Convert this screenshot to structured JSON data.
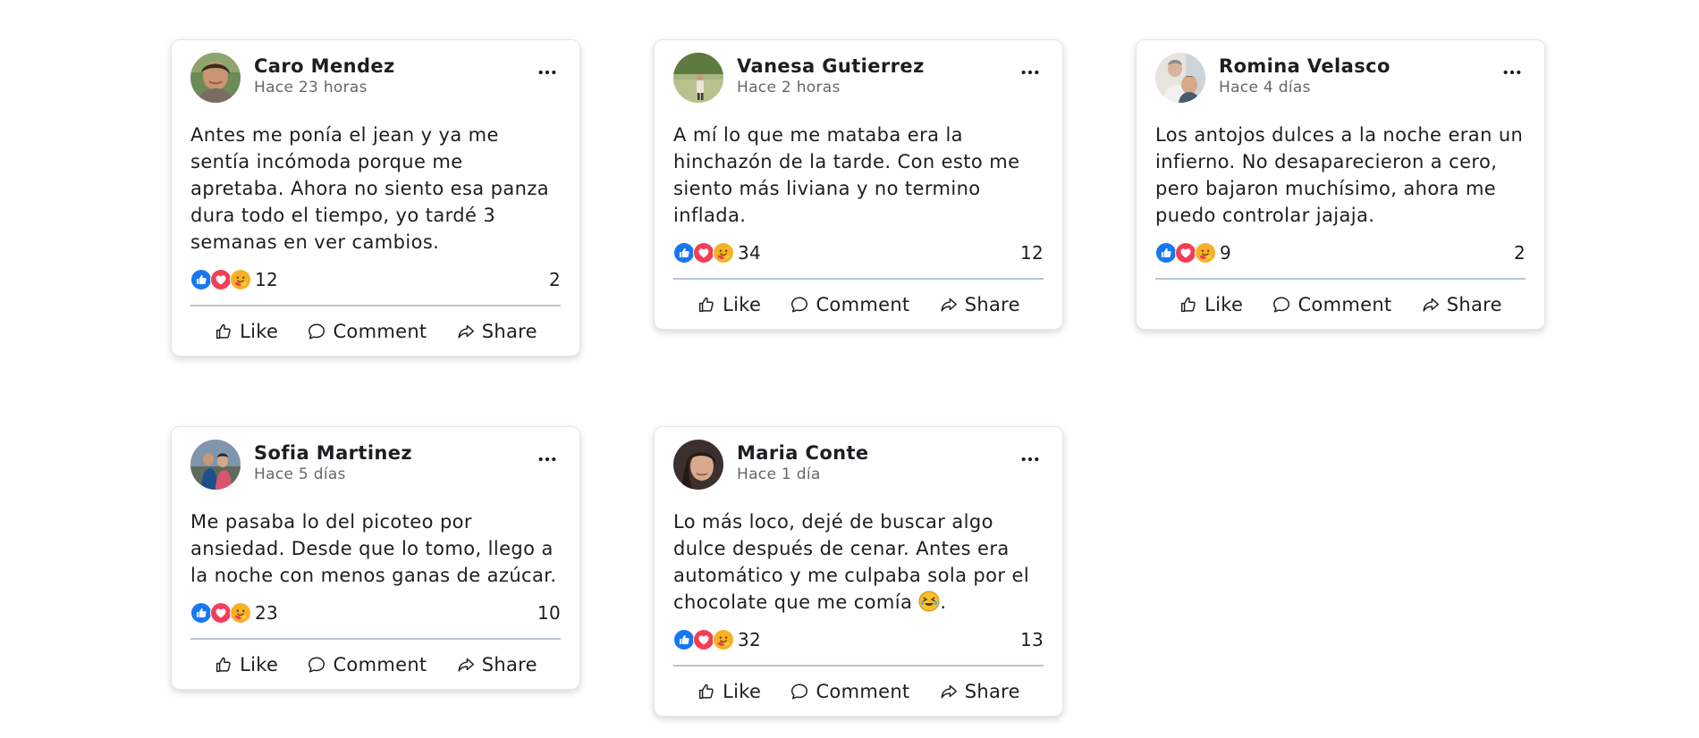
{
  "actions": {
    "like": "Like",
    "comment": "Comment",
    "share": "Share"
  },
  "colors": {
    "like_blue": "#1877f2",
    "love_red": "#f33e58",
    "care_yellow": "#f7b125",
    "meta_gray": "#65676b",
    "divider": "#b9c4cf"
  },
  "posts": [
    {
      "author": "Caro Mendez",
      "time": "Hace 23 horas",
      "text": "Antes me ponía el jean y ya me\nsentía incómoda porque me\napretaba. Ahora no siento esa panza\ndura todo el tiempo, yo tardé 3\nsemanas en ver cambios.",
      "reactions": "12",
      "comments": "2",
      "reaction_icons": [
        "like-icon",
        "love-icon",
        "care-icon"
      ]
    },
    {
      "author": "Vanesa Gutierrez",
      "time": "Hace 2 horas",
      "text": "A mí lo que me mataba era la\nhinchazón de la tarde. Con esto me\nsiento más liviana y no termino\ninflada.",
      "reactions": "34",
      "comments": "12",
      "reaction_icons": [
        "like-icon",
        "love-icon",
        "care-icon"
      ]
    },
    {
      "author": "Romina Velasco",
      "time": "Hace 4 días",
      "text": "Los antojos dulces a la noche eran un\ninfierno. No desaparecieron a cero,\npero bajaron muchísimo, ahora me\npuedo controlar jajaja.",
      "reactions": "9",
      "comments": "2",
      "reaction_icons": [
        "like-icon",
        "love-icon",
        "care-icon"
      ]
    },
    {
      "author": "Sofia Martinez",
      "time": "Hace 5 días",
      "text": "Me pasaba lo del picoteo por\nansiedad. Desde que lo tomo, llego a\nla noche con menos ganas de azúcar.",
      "reactions": "23",
      "comments": "10",
      "reaction_icons": [
        "like-icon",
        "love-icon",
        "care-icon"
      ]
    },
    {
      "author": "Maria Conte",
      "time": "Hace 1 día",
      "text": "Lo más loco, dejé de buscar algo\ndulce después de cenar. Antes era\nautomático y me culpaba sola por el\nchocolate que me comía",
      "text_suffix": ".",
      "inline_emoji": "rolling-laughing-emoji",
      "reactions": "32",
      "comments": "13",
      "reaction_icons": [
        "like-icon",
        "love-icon",
        "care-icon"
      ]
    }
  ]
}
